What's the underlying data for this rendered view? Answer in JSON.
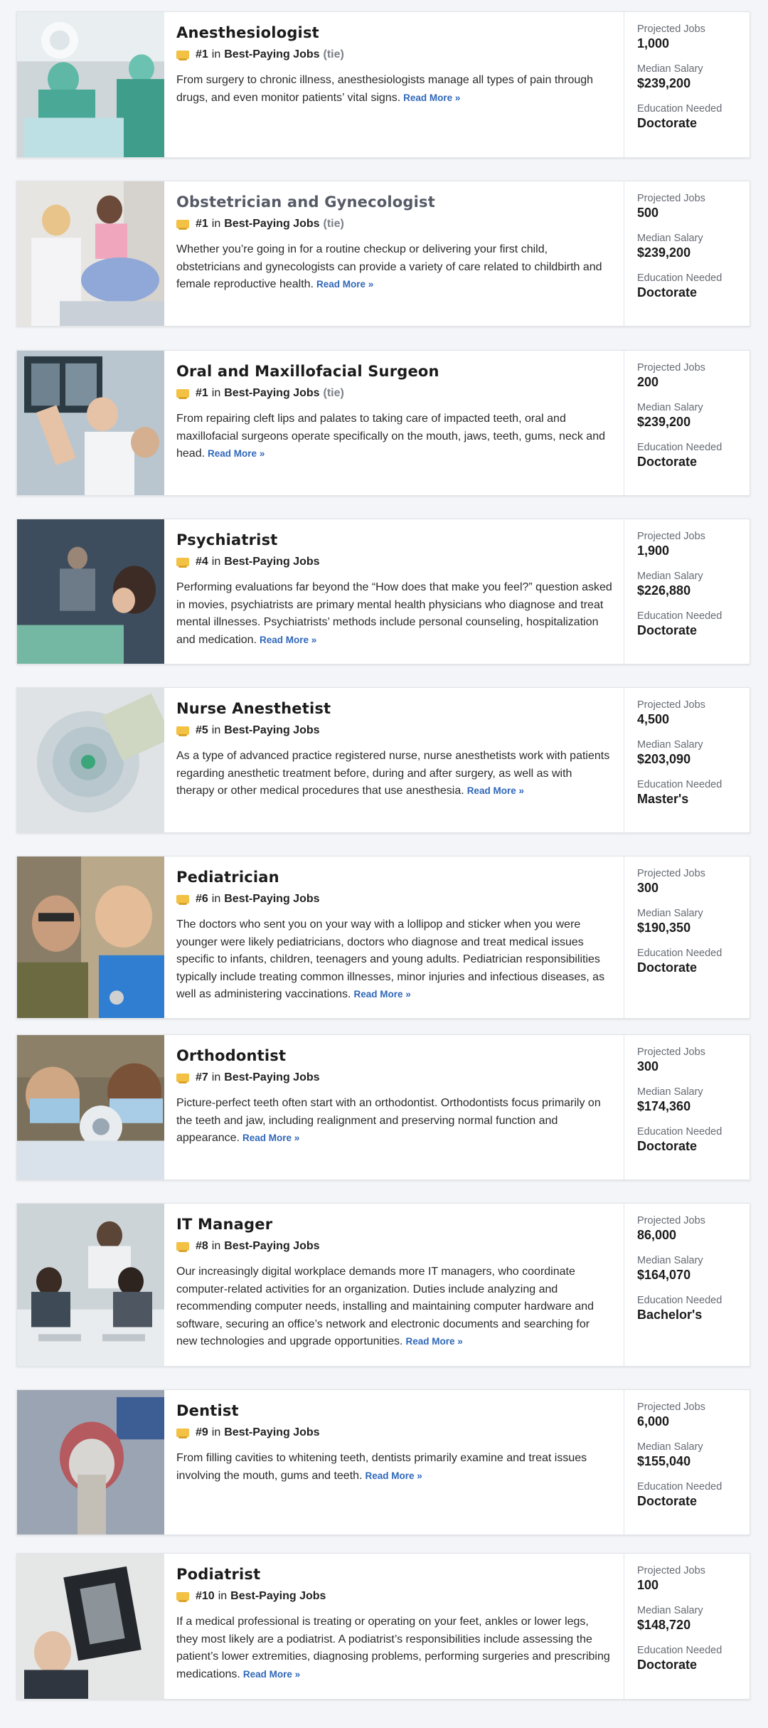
{
  "labels": {
    "in": "in",
    "list": "Best-Paying Jobs",
    "read_more": "Read More »",
    "projected_jobs": "Projected Jobs",
    "median_salary": "Median Salary",
    "education_needed": "Education Needed"
  },
  "colors": {
    "background": "#f4f5f8",
    "link": "#2f67b9",
    "badge": "#f3c244"
  },
  "jobs": [
    {
      "title": "Anesthesiologist",
      "rank": "#1",
      "tie": "(tie)",
      "description": "From surgery to chronic illness, anesthesiologists manage all types of pain through drugs, and even monitor patients’ vital signs.",
      "projected_jobs": "1,000",
      "median_salary": "$239,200",
      "education": "Doctorate",
      "image": "surgeons-operating-photo"
    },
    {
      "title": "Obstetrician and Gynecologist",
      "rank": "#1",
      "tie": "(tie)",
      "description": "Whether you’re going in for a routine checkup or delivering your first child, obstetricians and gynecologists can provide a variety of care related to childbirth and female reproductive health.",
      "projected_jobs": "500",
      "median_salary": "$239,200",
      "education": "Doctorate",
      "image": "doctor-with-patient-photo"
    },
    {
      "title": "Oral and Maxillofacial Surgeon",
      "rank": "#1",
      "tie": "(tie)",
      "description": "From repairing cleft lips and palates to taking care of impacted teeth, oral and maxillofacial surgeons operate specifically on the mouth, jaws, teeth, gums, neck and head.",
      "projected_jobs": "200",
      "median_salary": "$239,200",
      "education": "Doctorate",
      "image": "surgeon-xray-photo"
    },
    {
      "title": "Psychiatrist",
      "rank": "#4",
      "tie": "",
      "description": "Performing evaluations far beyond the “How does that make you feel?” question asked in movies, psychiatrists are primary mental health physicians who diagnose and treat mental illnesses. Psychiatrists’ methods include personal counseling, hospitalization and medication.",
      "projected_jobs": "1,900",
      "median_salary": "$226,880",
      "education": "Doctorate",
      "image": "therapy-session-photo"
    },
    {
      "title": "Nurse Anesthetist",
      "rank": "#5",
      "tie": "",
      "description": "As a type of advanced practice registered nurse, nurse anesthetists work with patients regarding anesthetic treatment before, during and after surgery, as well as with therapy or other medical procedures that use anesthesia.",
      "projected_jobs": "4,500",
      "median_salary": "$203,090",
      "education": "Master's",
      "image": "anesthesia-mask-photo"
    },
    {
      "title": "Pediatrician",
      "rank": "#6",
      "tie": "",
      "description": "The doctors who sent you on your way with a lollipop and sticker when you were younger were likely pediatricians, doctors who diagnose and treat medical issues specific to infants, children, teenagers and young adults. Pediatrician responsibilities typically include treating common illnesses, minor injuries and infectious diseases, as well as administering vaccinations.",
      "projected_jobs": "300",
      "median_salary": "$190,350",
      "education": "Doctorate",
      "image": "doctor-and-child-photo"
    },
    {
      "title": "Orthodontist",
      "rank": "#7",
      "tie": "",
      "description": "Picture-perfect teeth often start with an orthodontist. Orthodontists focus primarily on the teeth and jaw, including realignment and preserving normal function and appearance.",
      "projected_jobs": "300",
      "median_salary": "$174,360",
      "education": "Doctorate",
      "image": "dentists-looking-down-photo"
    },
    {
      "title": "IT Manager",
      "rank": "#8",
      "tie": "",
      "description": "Our increasingly digital workplace demands more IT managers, who coordinate computer-related activities for an organization. Duties include analyzing and recommending computer needs, installing and maintaining computer hardware and software, securing an office’s network and electronic documents and searching for new technologies and upgrade opportunities.",
      "projected_jobs": "86,000",
      "median_salary": "$164,070",
      "education": "Bachelor's",
      "image": "office-team-overhead-photo"
    },
    {
      "title": "Dentist",
      "rank": "#9",
      "tie": "",
      "description": "From filling cavities to whitening teeth, dentists primarily examine and treat issues involving the mouth, gums and teeth.",
      "projected_jobs": "6,000",
      "median_salary": "$155,040",
      "education": "Doctorate",
      "image": "dental-chair-photo"
    },
    {
      "title": "Podiatrist",
      "rank": "#10",
      "tie": "",
      "description": "If a medical professional is treating or operating on your feet, ankles or lower legs, they most likely are a podiatrist. A podiatrist’s responsibilities include assessing the patient’s lower extremities, diagnosing problems, performing surgeries and prescribing medications.",
      "projected_jobs": "100",
      "median_salary": "$148,720",
      "education": "Doctorate",
      "image": "doctor-xray-foot-photo"
    }
  ]
}
